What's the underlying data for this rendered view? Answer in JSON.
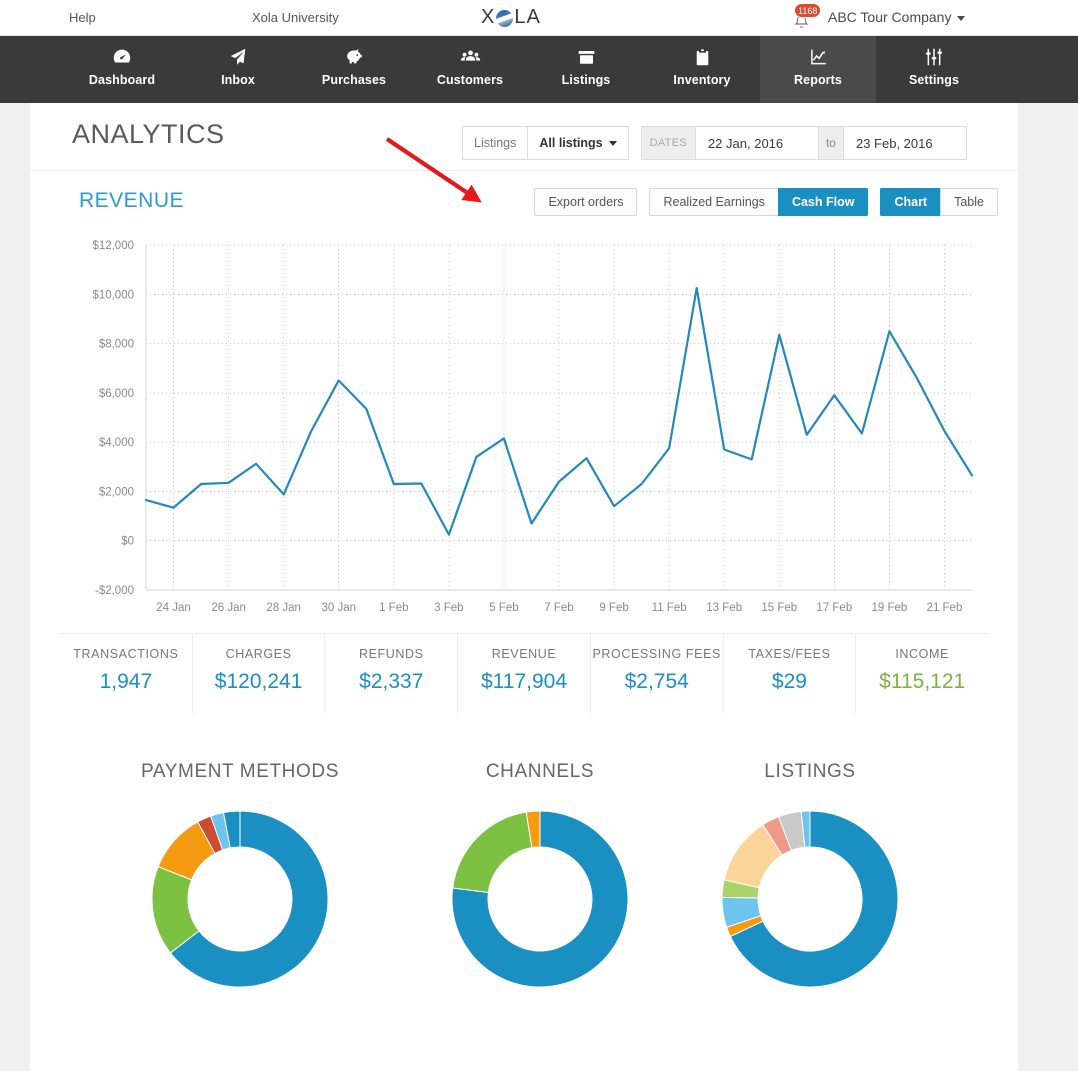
{
  "topbar": {
    "help": "Help",
    "university": "Xola University",
    "logo": "XOLA",
    "logo_part1": "X",
    "logo_part2": "LA",
    "notification_count": "1168",
    "account": "ABC Tour Company"
  },
  "nav": {
    "items": [
      {
        "label": "Dashboard",
        "icon": "gauge-icon",
        "active": false
      },
      {
        "label": "Inbox",
        "icon": "paper-plane-icon",
        "active": false
      },
      {
        "label": "Purchases",
        "icon": "piggy-bank-icon",
        "active": false
      },
      {
        "label": "Customers",
        "icon": "people-group-icon",
        "active": false
      },
      {
        "label": "Listings",
        "icon": "archive-box-icon",
        "active": false
      },
      {
        "label": "Inventory",
        "icon": "clipboard-icon",
        "active": false
      },
      {
        "label": "Reports",
        "icon": "line-chart-icon",
        "active": true
      },
      {
        "label": "Settings",
        "icon": "sliders-icon",
        "active": false
      }
    ]
  },
  "page": {
    "title": "ANALYTICS"
  },
  "filters": {
    "listings_label": "Listings",
    "listings_value": "All listings",
    "dates_label": "DATES",
    "date_from": "22 Jan, 2016",
    "date_to_label": "to",
    "date_to": "23 Feb, 2016"
  },
  "revenue": {
    "title": "REVENUE",
    "export_button": "Export orders",
    "mode_toggle": [
      "Realized Earnings",
      "Cash Flow"
    ],
    "mode_selected": "Cash Flow",
    "view_toggle": [
      "Chart",
      "Table"
    ],
    "view_selected": "Chart"
  },
  "metrics": [
    {
      "label": "TRANSACTIONS",
      "value": "1,947",
      "color": "#1a8fc1"
    },
    {
      "label": "CHARGES",
      "value": "$120,241",
      "color": "#1a8fc1"
    },
    {
      "label": "REFUNDS",
      "value": "$2,337",
      "color": "#1a8fc1"
    },
    {
      "label": "REVENUE",
      "value": "$117,904",
      "color": "#1a8fc1"
    },
    {
      "label": "PROCESSING FEES",
      "value": "$2,754",
      "color": "#1a8fc1"
    },
    {
      "label": "TAXES/FEES",
      "value": "$29",
      "color": "#1a8fc1"
    },
    {
      "label": "INCOME",
      "value": "$115,121",
      "color": "#7cb342"
    }
  ],
  "donuts": [
    {
      "title": "PAYMENT METHODS",
      "segments": [
        {
          "value": 64.5,
          "color": "#1a8fc1"
        },
        {
          "value": 16.5,
          "color": "#7cc142"
        },
        {
          "value": 11.0,
          "color": "#f59b10"
        },
        {
          "value": 2.6,
          "color": "#cc4b31"
        },
        {
          "value": 2.4,
          "color": "#6cc4ef"
        },
        {
          "value": 3.0,
          "color": "#1a8fc1"
        }
      ]
    },
    {
      "title": "CHANNELS",
      "segments": [
        {
          "value": 77.0,
          "color": "#1a8fc1"
        },
        {
          "value": 20.5,
          "color": "#7cc142"
        },
        {
          "value": 2.5,
          "color": "#f59b10"
        }
      ]
    },
    {
      "title": "LISTINGS",
      "segments": [
        {
          "value": 68.0,
          "color": "#1a8fc1"
        },
        {
          "value": 1.8,
          "color": "#f59b10"
        },
        {
          "value": 5.5,
          "color": "#6cc4ef"
        },
        {
          "value": 3.2,
          "color": "#a9d468"
        },
        {
          "value": 12.5,
          "color": "#fbd49a"
        },
        {
          "value": 3.2,
          "color": "#ef9a86"
        },
        {
          "value": 4.2,
          "color": "#c9c9c9"
        },
        {
          "value": 1.6,
          "color": "#6cc4ef"
        }
      ]
    }
  ],
  "annotation": {
    "type": "arrow",
    "color": "#e8171b",
    "points": "from (386,139) to (478,201)"
  },
  "chart_data": {
    "type": "line",
    "title": "REVENUE",
    "xlabel": "",
    "ylabel": "",
    "ylim": [
      -2000,
      12000
    ],
    "ytick_labels": [
      "$12,000",
      "$10,000",
      "$8,000",
      "$6,000",
      "$4,000",
      "$2,000",
      "$0",
      "-$2,000"
    ],
    "ytick_values": [
      12000,
      10000,
      8000,
      6000,
      4000,
      2000,
      0,
      -2000
    ],
    "xtick_labels": [
      "24 Jan",
      "26 Jan",
      "28 Jan",
      "30 Jan",
      "1 Feb",
      "3 Feb",
      "5 Feb",
      "7 Feb",
      "9 Feb",
      "11 Feb",
      "13 Feb",
      "15 Feb",
      "17 Feb",
      "19 Feb",
      "21 Feb"
    ],
    "grid": true,
    "legend": "none",
    "line_color": "#2389b8",
    "x": [
      "23 Jan",
      "24 Jan",
      "25 Jan",
      "26 Jan",
      "27 Jan",
      "28 Jan",
      "29 Jan",
      "30 Jan",
      "31 Jan",
      "1 Feb",
      "2 Feb",
      "3 Feb",
      "4 Feb",
      "5 Feb",
      "6 Feb",
      "7 Feb",
      "8 Feb",
      "9 Feb",
      "10 Feb",
      "11 Feb",
      "12 Feb",
      "13 Feb",
      "14 Feb",
      "15 Feb",
      "16 Feb",
      "17 Feb",
      "18 Feb",
      "19 Feb",
      "20 Feb",
      "21 Feb",
      "22 Feb"
    ],
    "values": [
      1650,
      1340,
      2300,
      2350,
      3120,
      1880,
      4450,
      6500,
      5350,
      2300,
      2320,
      250,
      3400,
      4150,
      700,
      2400,
      3350,
      1400,
      2300,
      3750,
      10250,
      3700,
      3300,
      8350,
      4300,
      5900,
      4350,
      8500,
      6600,
      4450,
      2650
    ]
  }
}
